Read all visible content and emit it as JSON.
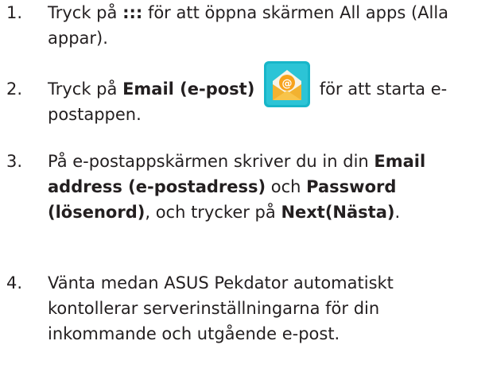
{
  "steps": [
    {
      "number": "1.",
      "before": "Tryck på ",
      "symbol": ":::",
      "after": " för att öppna skärmen All apps (Alla appar)."
    },
    {
      "number": "2.",
      "before": "Tryck på ",
      "bold": "Email (e-post)",
      "icon": "email-app-icon",
      "after": " för att starta e-postappen."
    },
    {
      "number": "3.",
      "before": "På e-postappskärmen skriver du in din ",
      "bold1": "Email address (e-postadress)",
      "mid1": " och ",
      "bold2": "Password (lösenord)",
      "mid2": ", och trycker på ",
      "bold3": "Next(Nästa)",
      "after": "."
    },
    {
      "number": "4.",
      "text": "Vänta medan ASUS Pekdator automatiskt kontollerar serverinställningarna för din inkommande och utgående e-post."
    }
  ],
  "colors": {
    "text": "#231f20",
    "icon_orange": "#f7a21b",
    "icon_teal": "#17b6c9"
  }
}
